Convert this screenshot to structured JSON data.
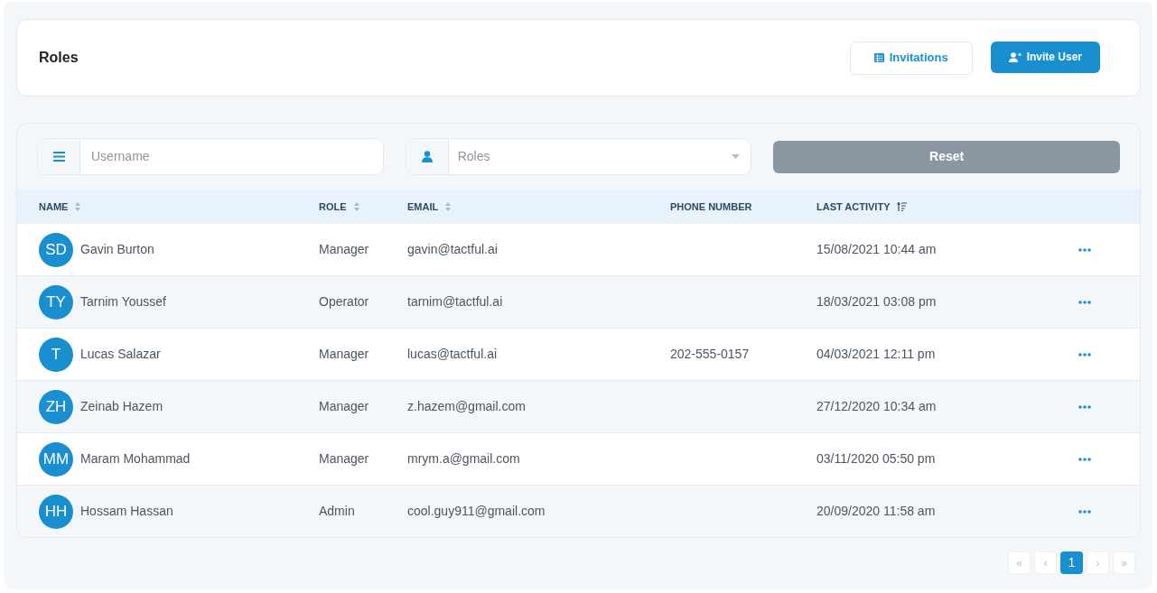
{
  "header": {
    "title": "Roles",
    "buttons": [
      {
        "kind": "outline",
        "label": "Invitations"
      },
      {
        "kind": "primary",
        "label": "Invite User"
      }
    ]
  },
  "filters": {
    "username": {
      "placeholder": "Username"
    },
    "roles": {
      "placeholder": "Roles"
    },
    "reset": "Reset"
  },
  "table": {
    "columns": [
      {
        "label": "NAME",
        "kind": "sortable"
      },
      {
        "label": "ROLE",
        "kind": "sortable"
      },
      {
        "label": "EMAIL",
        "kind": "sortable"
      },
      {
        "label": "PHONE NUMBER",
        "kind": "plain"
      },
      {
        "label": "LAST ACTIVITY",
        "kind": "sorted"
      }
    ],
    "rows": [
      {
        "initials": "SD",
        "name": "Gavin Burton",
        "role": "Manager",
        "email": "gavin@tactful.ai",
        "last_activity": "15/08/2021 10:44 am"
      },
      {
        "initials": "TY",
        "name": "Tarnim Youssef",
        "role": "Operator",
        "email": "tarnim@tactful.ai",
        "last_activity": "18/03/2021 03:08 pm"
      },
      {
        "initials": "T",
        "name": "Lucas Salazar",
        "role": "Manager",
        "email": "lucas@tactful.ai",
        "phone": "202-555-0157",
        "last_activity": "04/03/2021 12:11 pm"
      },
      {
        "initials": "ZH",
        "name": "Zeinab Hazem",
        "role": "Manager",
        "email": "z.hazem@gmail.com",
        "last_activity": "27/12/2020 10:34 am"
      },
      {
        "initials": "MM",
        "name": "Maram Mohammad",
        "role": "Manager",
        "email": "mrym.a@gmail.com",
        "last_activity": "03/11/2020 05:50 pm"
      },
      {
        "initials": "HH",
        "name": "Hossam Hassan",
        "role": "Admin",
        "email": "cool.guy911@gmail.com",
        "last_activity": "20/09/2020 11:58 am"
      }
    ]
  },
  "pagination": [
    {
      "label": "«",
      "selected": false
    },
    {
      "label": "‹",
      "selected": false
    },
    {
      "label": "1",
      "selected": true
    },
    {
      "label": "›",
      "selected": false
    },
    {
      "label": "»",
      "selected": false
    }
  ]
}
